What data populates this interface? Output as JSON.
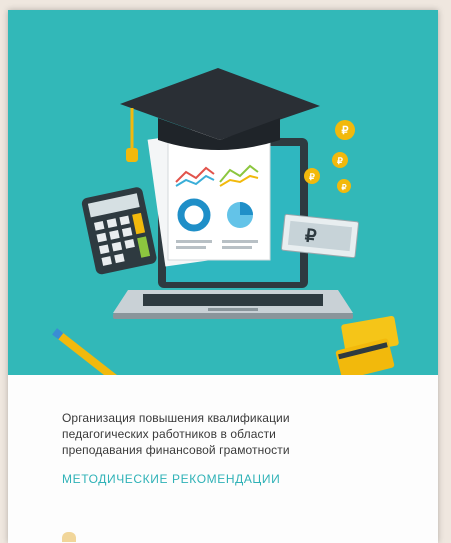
{
  "document": {
    "title": "Организация повышения квалификации\nпедагогических работников в области\nпреподавания финансовой грамотности",
    "subtitle": "МЕТОДИЧЕСКИЕ РЕКОМЕНДАЦИИ"
  },
  "illustration": {
    "icons": [
      "graduation-cap-icon",
      "laptop-icon",
      "calculator-icon",
      "pencil-icon",
      "banknote-icon",
      "coin-icon",
      "bank-card-icon"
    ],
    "coin_symbol": "₽",
    "colors": {
      "hero_background": "#32b8b8",
      "subtitle": "#2fb2b7",
      "coin": "#f2b90c",
      "cap": "#2a2f35"
    }
  }
}
